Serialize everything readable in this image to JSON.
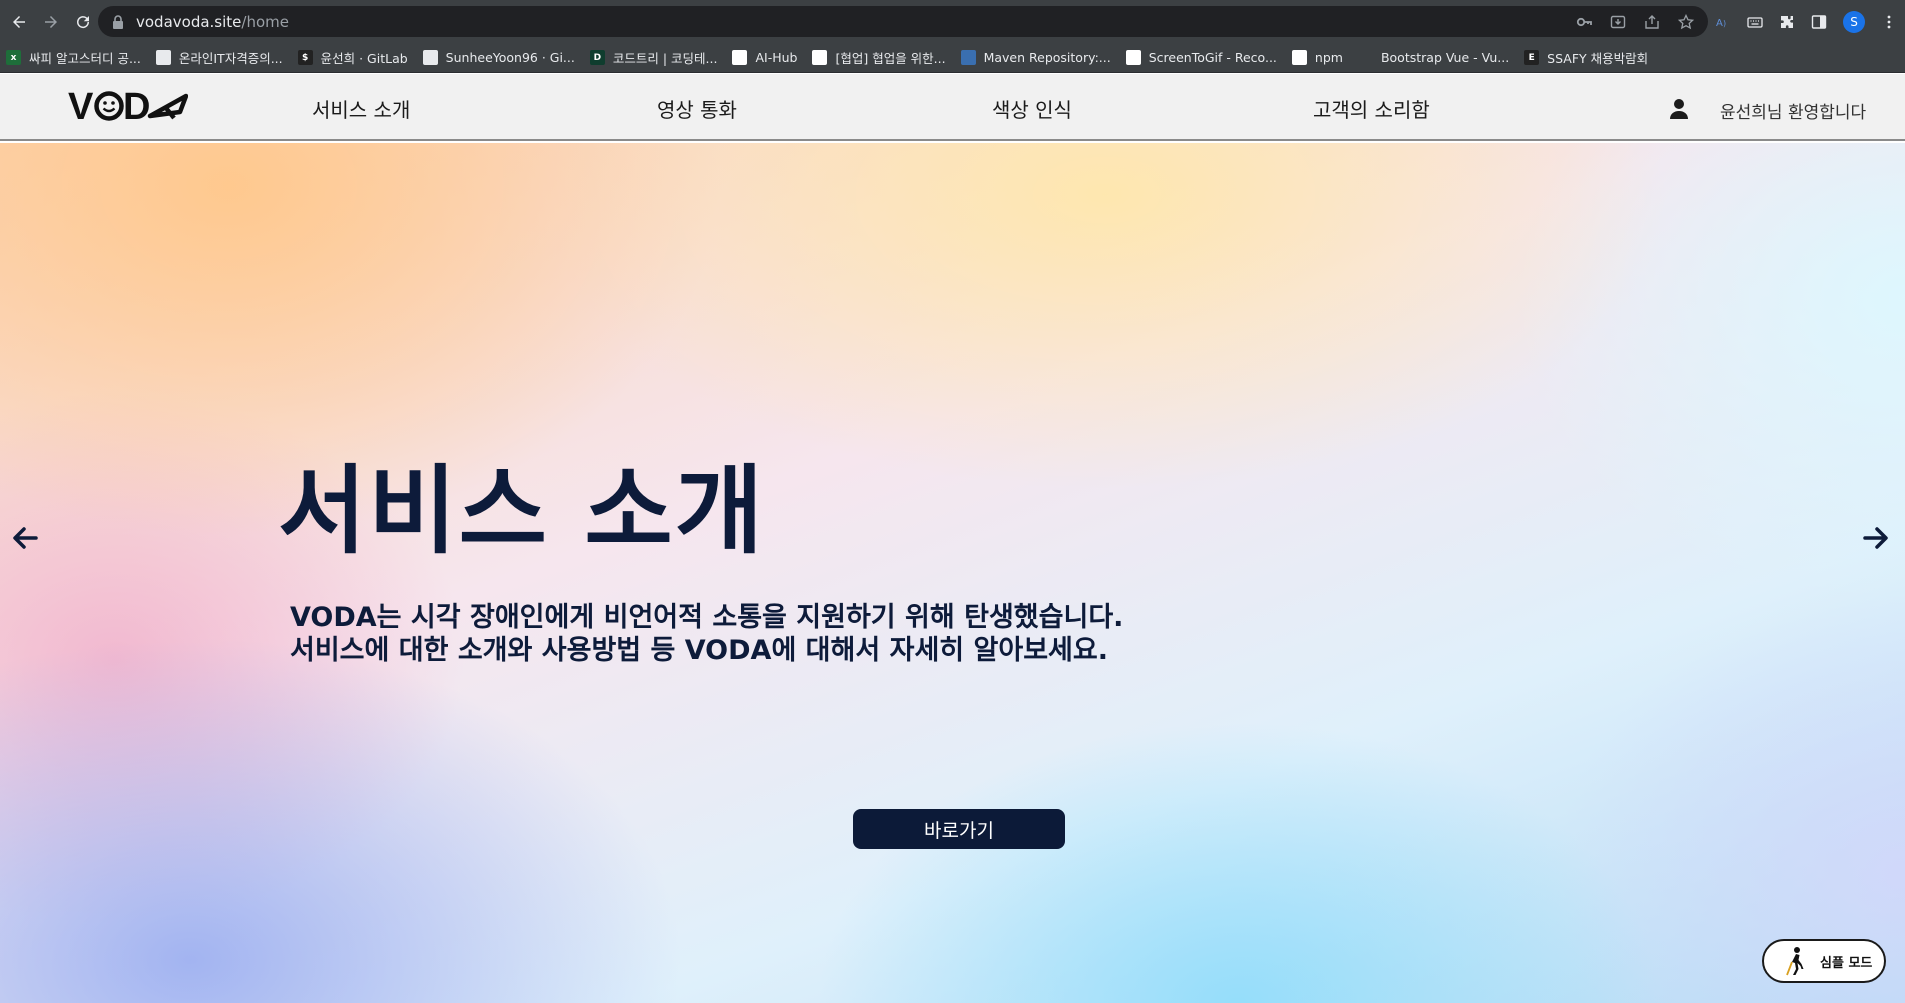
{
  "browser": {
    "url_domain": "vodavoda.site",
    "url_path": "/home",
    "profile_initial": "S",
    "bookmarks": [
      {
        "label": "싸피 알고스터디 공...",
        "color": "#1e6e3a",
        "glyph": "x"
      },
      {
        "label": "온라인IT자격증의...",
        "color": "#e8eaed",
        "glyph": ""
      },
      {
        "label": "윤선희 · GitLab",
        "color": "#222222",
        "glyph": "$"
      },
      {
        "label": "SunheeYoon96 · Gi...",
        "color": "#e8eaed",
        "glyph": ""
      },
      {
        "label": "코드트리 | 코딩테...",
        "color": "#0f3d2e",
        "glyph": "D"
      },
      {
        "label": "AI-Hub",
        "color": "#ffffff",
        "glyph": ""
      },
      {
        "label": "[협업] 협업을 위한...",
        "color": "#ffffff",
        "glyph": ""
      },
      {
        "label": "Maven Repository:...",
        "color": "#3a6fb0",
        "glyph": ""
      },
      {
        "label": "ScreenToGif - Reco...",
        "color": "#ffffff",
        "glyph": ""
      },
      {
        "label": "npm",
        "color": "#ffffff",
        "glyph": "n"
      },
      {
        "label": "Bootstrap Vue - Vu...",
        "color": "#3c4043",
        "glyph": ""
      },
      {
        "label": "SSAFY 채용박람회",
        "color": "#222222",
        "glyph": "E"
      }
    ]
  },
  "header": {
    "logo": "VODA",
    "menu": [
      "서비스 소개",
      "영상 통화",
      "색상 인식",
      "고객의 소리함"
    ],
    "welcome": "윤선희님 환영합니다"
  },
  "hero": {
    "title": "서비스 소개",
    "desc_line1": "VODA는 시각 장애인에게 비언어적 소통을 지원하기 위해 탄생했습니다.",
    "desc_line2": "서비스에 대한 소개와 사용방법 등 VODA에 대해서 자세히 알아보세요.",
    "button": "바로가기"
  },
  "simple_mode": {
    "label": "심플 모드"
  },
  "colors": {
    "primary": "#0c1a38",
    "chrome": "#3c4043"
  }
}
